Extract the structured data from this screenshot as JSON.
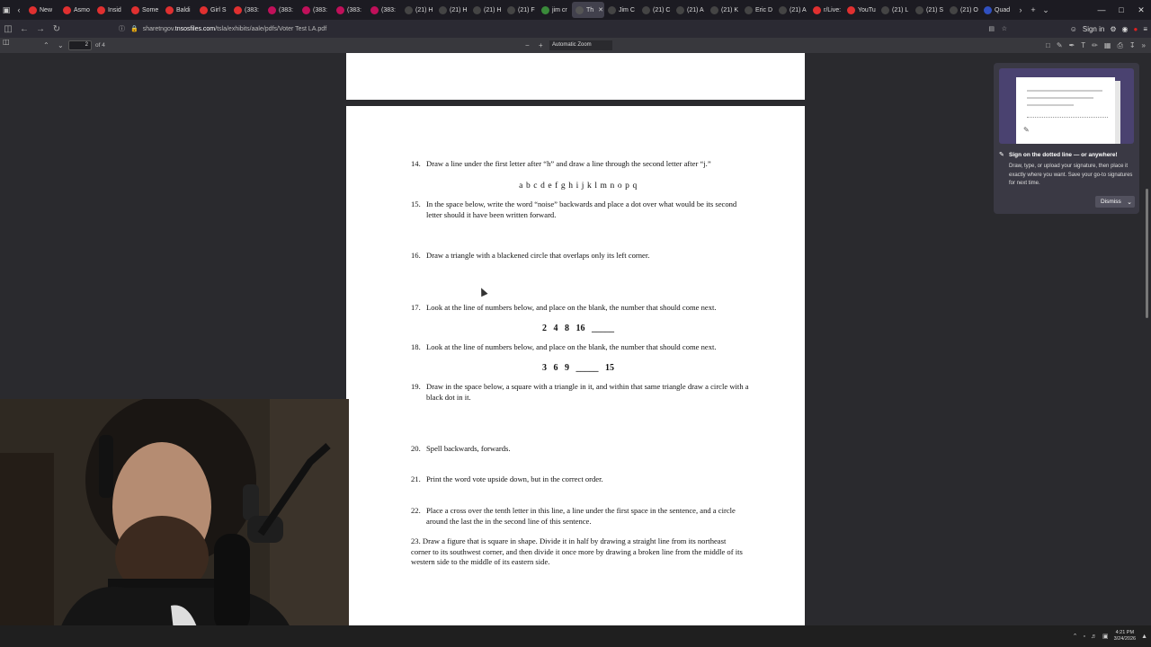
{
  "tabs": [
    {
      "label": "New",
      "color": "#e03030"
    },
    {
      "label": "Asmo",
      "color": "#e03030"
    },
    {
      "label": "Insid",
      "color": "#e03030"
    },
    {
      "label": "Some",
      "color": "#e03030"
    },
    {
      "label": "Baldi",
      "color": "#e03030"
    },
    {
      "label": "Girl S",
      "color": "#e03030"
    },
    {
      "label": "(383:",
      "color": "#e03030"
    },
    {
      "label": "(383:",
      "color": "#c0105a"
    },
    {
      "label": "(383:",
      "color": "#c0105a"
    },
    {
      "label": "(383:",
      "color": "#c0105a"
    },
    {
      "label": "(383:",
      "color": "#c0105a"
    },
    {
      "label": "(21) H",
      "color": "#444"
    },
    {
      "label": "(21) H",
      "color": "#444"
    },
    {
      "label": "(21) H",
      "color": "#444"
    },
    {
      "label": "(21) F",
      "color": "#444"
    },
    {
      "label": "jim cr",
      "color": "#3a8a3a"
    },
    {
      "label": "Th",
      "color": "#555",
      "active": true
    },
    {
      "label": "Jim C",
      "color": "#444"
    },
    {
      "label": "(21) C",
      "color": "#444"
    },
    {
      "label": "(21) A",
      "color": "#444"
    },
    {
      "label": "(21) K",
      "color": "#444"
    },
    {
      "label": "Eric D",
      "color": "#444"
    },
    {
      "label": "(21) A",
      "color": "#444"
    },
    {
      "label": "r/Live:",
      "color": "#e03030"
    },
    {
      "label": "YouTu",
      "color": "#e03030"
    },
    {
      "label": "(21) L",
      "color": "#444"
    },
    {
      "label": "(21) S",
      "color": "#444"
    },
    {
      "label": "(21) O",
      "color": "#444"
    },
    {
      "label": "Quad",
      "color": "#3050c0"
    }
  ],
  "url": {
    "prefix": "sharetngov.",
    "domain": "tnsosfiles.com",
    "path": "/tsla/exhibits/aale/pdfs/Voter Test LA.pdf"
  },
  "nav": {
    "sign_in": "Sign in"
  },
  "pdf": {
    "page": "2",
    "of": "of 4",
    "zoom": "Automatic Zoom"
  },
  "doc": {
    "q14": {
      "num": "14.",
      "text": "Draw a line under the first letter after “h” and draw a line through the second letter after “j.”"
    },
    "q14_letters": "a b c d e f g h i j k l m n o p q",
    "q15": {
      "num": "15.",
      "text": "In the space below, write the word “noise” backwards and place a dot over what would be its second letter should it have been written forward."
    },
    "q16": {
      "num": "16.",
      "text": "Draw a triangle with a blackened circle that overlaps only its left corner."
    },
    "q17": {
      "num": "17.",
      "text": "Look at the line of numbers below, and place on the blank, the number that should come next."
    },
    "q17_seq": "2   4   8   16   _____",
    "q18": {
      "num": "18.",
      "text": "Look at the line of numbers below, and place on the blank, the number that should come next."
    },
    "q18_seq": "3   6   9   _____   15",
    "q19": {
      "num": "19.",
      "text": "Draw in the space below, a square with a triangle in it, and within that same triangle draw a circle with a black dot in it."
    },
    "q20": {
      "num": "20.",
      "text": "Spell backwards, forwards."
    },
    "q21": {
      "num": "21.",
      "text": "Print the word vote upside down, but in the correct order."
    },
    "q22": {
      "num": "22.",
      "text": "Place a cross over the tenth letter in this line, a line under the first space in the sentence, and a circle around the last the in the second line of this sentence."
    },
    "q23": {
      "text": "23.  Draw a figure that is square in shape.  Divide it in half by drawing a straight line from its northeast corner to its southwest corner, and then divide it once more by drawing a broken line from the middle of its western side to the middle of its eastern side."
    }
  },
  "popup": {
    "title": "Sign on the dotted line — or anywhere!",
    "body": "Draw, type, or upload your signature, then place it exactly where you want. Save your go-to signatures for next time.",
    "dismiss": "Dismiss"
  },
  "clock": {
    "time": "4:21 PM",
    "date": "3/24/2026"
  }
}
